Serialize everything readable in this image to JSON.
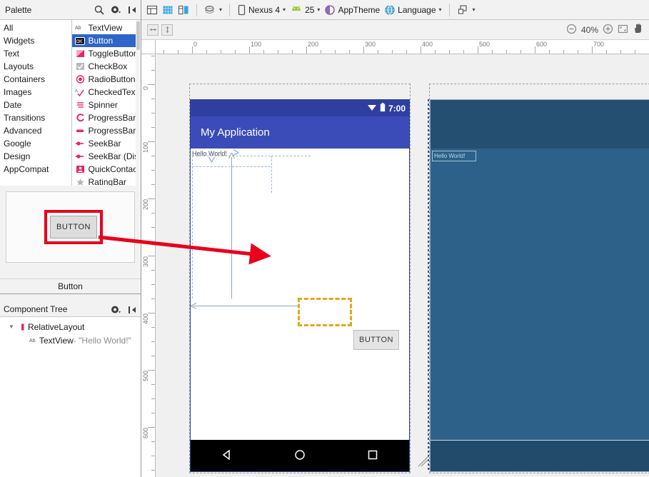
{
  "palette": {
    "title": "Palette",
    "header_icons": [
      "search-icon",
      "gear-icon",
      "collapse-icon"
    ],
    "categories": [
      {
        "label": "All"
      },
      {
        "label": "Widgets"
      },
      {
        "label": "Text"
      },
      {
        "label": "Layouts"
      },
      {
        "label": "Containers"
      },
      {
        "label": "Images"
      },
      {
        "label": "Date"
      },
      {
        "label": "Transitions"
      },
      {
        "label": "Advanced"
      },
      {
        "label": "Google"
      },
      {
        "label": "Design"
      },
      {
        "label": "AppCompat"
      }
    ],
    "widgets": [
      {
        "label": "TextView",
        "icon": "textview-icon",
        "selected": false
      },
      {
        "label": "Button",
        "icon": "button-icon",
        "selected": true
      },
      {
        "label": "ToggleButton",
        "icon": "togglebutton-icon",
        "selected": false
      },
      {
        "label": "CheckBox",
        "icon": "checkbox-icon",
        "selected": false
      },
      {
        "label": "RadioButton",
        "icon": "radiobutton-icon",
        "selected": false
      },
      {
        "label": "CheckedTextView",
        "icon": "checkedtextview-icon",
        "selected": false
      },
      {
        "label": "Spinner",
        "icon": "spinner-icon",
        "selected": false
      },
      {
        "label": "ProgressBar",
        "icon": "progressbar-icon",
        "selected": false
      },
      {
        "label": "ProgressBar",
        "icon": "progressbar-h-icon",
        "selected": false
      },
      {
        "label": "SeekBar",
        "icon": "seekbar-icon",
        "selected": false
      },
      {
        "label": "SeekBar (Dis",
        "icon": "seekbar-icon",
        "selected": false
      },
      {
        "label": "QuickContac",
        "icon": "quickcontact-icon",
        "selected": false
      },
      {
        "label": "RatingBar",
        "icon": "ratingbar-icon",
        "selected": false
      }
    ],
    "preview": {
      "button_text": "BUTTON",
      "caption": "Button",
      "highlight_color": "#e8001c"
    }
  },
  "component_tree": {
    "title": "Component Tree",
    "header_icons": [
      "gear-icon",
      "collapse-icon"
    ],
    "nodes": [
      {
        "label": "RelativeLayout",
        "detail": "",
        "icon": "relativelayout-icon",
        "indent": 0
      },
      {
        "label": "TextView",
        "detail": " - \"Hello World!\"",
        "icon": "textview-icon",
        "indent": 1
      }
    ]
  },
  "toolbar": {
    "view_modes": [
      "design-mode-icon",
      "blueprint-mode-icon",
      "split-mode-icon"
    ],
    "orientation_label": "",
    "device": "Nexus 4",
    "api_level": "25",
    "theme": "AppTheme",
    "language": "Language",
    "layout_variants_icon": "layout-variants-icon"
  },
  "zoombar": {
    "fit_width_icon": "fit-width-icon",
    "fit_height_icon": "fit-height-icon",
    "zoom_out_icon": "zoom-out-icon",
    "zoom_level": "40%",
    "zoom_in_icon": "zoom-in-icon",
    "zoom_fit_icon": "zoom-fit-icon",
    "pan_icon": "pan-hand-icon"
  },
  "ruler": {
    "horizontal_labels": [
      "0",
      "100",
      "200",
      "300",
      "400",
      "500",
      "600",
      "700"
    ],
    "vertical_labels": [
      "0",
      "100",
      "200",
      "300",
      "400",
      "500",
      "600"
    ]
  },
  "device_preview": {
    "status_time": "7:00",
    "status_icons": [
      "wifi-icon",
      "battery-icon"
    ],
    "app_title": "My Application",
    "hello_text": "Hello World!",
    "nav_icons": [
      "back-icon",
      "home-icon",
      "recents-icon"
    ],
    "appbar_color": "#3b4cb8",
    "statusbar_color": "#2f3ea0"
  },
  "blueprint_preview": {
    "hello_text": "Hello World!",
    "surface_color": "#2e6189",
    "chrome_color": "#244f71"
  },
  "drag_state": {
    "drop_target_color": "#e8a317",
    "ghost_button_text": "BUTTON",
    "arrow_color": "#e8001c"
  }
}
